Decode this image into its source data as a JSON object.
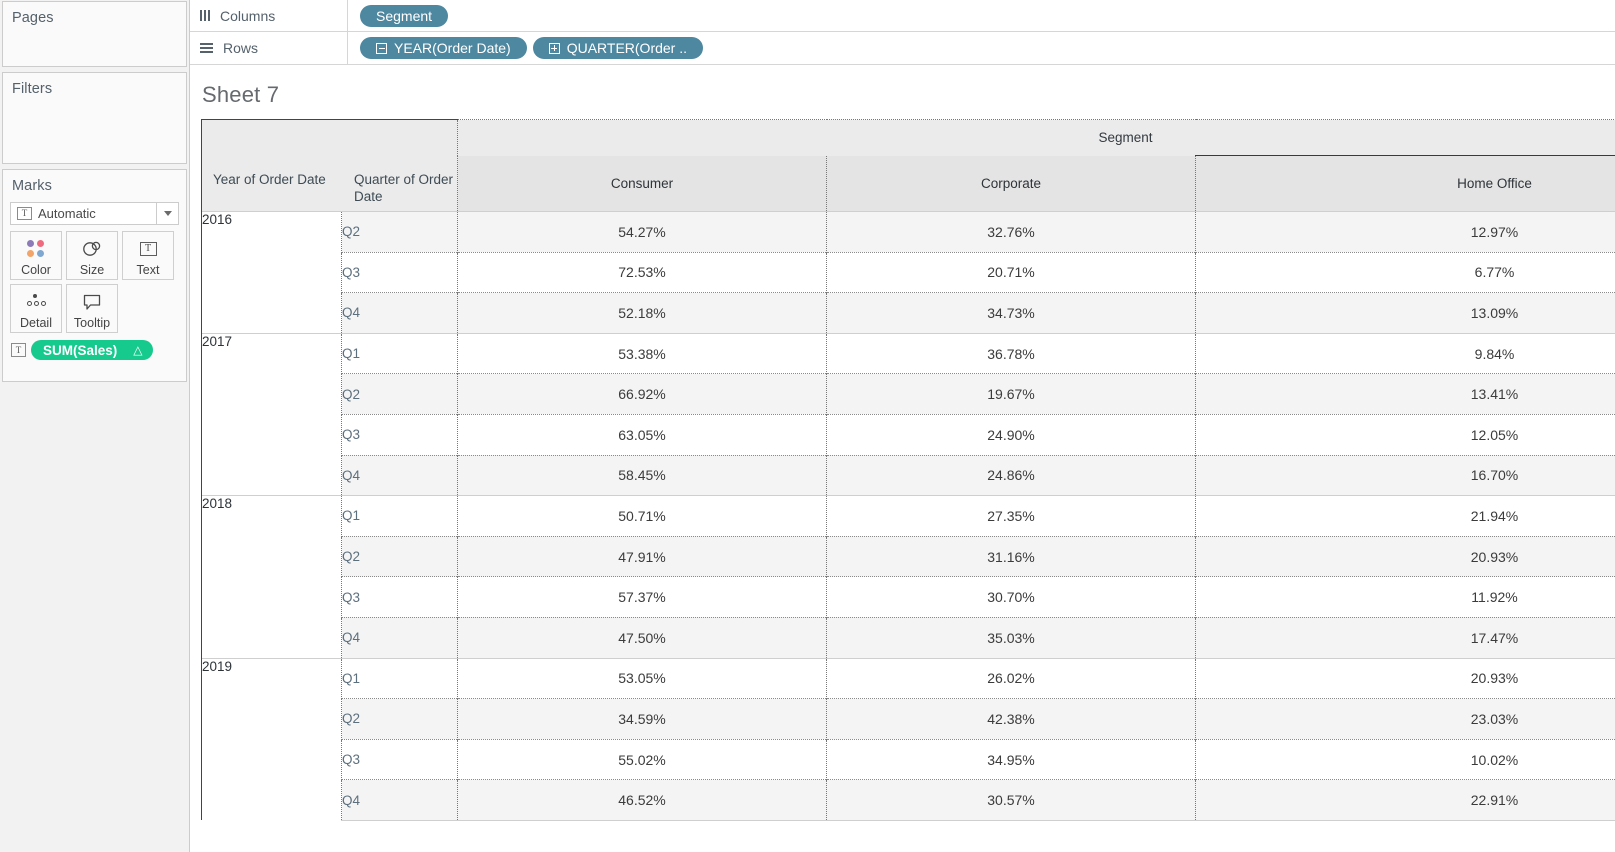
{
  "sidebar": {
    "pages": {
      "title": "Pages"
    },
    "filters": {
      "title": "Filters"
    },
    "marks": {
      "title": "Marks",
      "mark_type": "Automatic",
      "mark_type_glyph": "T",
      "buttons": [
        {
          "label": "Color",
          "icon": "color-dots-icon"
        },
        {
          "label": "Size",
          "icon": "size-circles-icon"
        },
        {
          "label": "Text",
          "icon": "text-box-icon"
        },
        {
          "label": "Detail",
          "icon": "detail-dots-icon"
        },
        {
          "label": "Tooltip",
          "icon": "tooltip-bubble-icon"
        }
      ],
      "card_pill": {
        "label": "SUM(Sales)",
        "glyph": "T",
        "badge": "△",
        "color": "#16c98d"
      }
    }
  },
  "shelves": {
    "columns": {
      "label": "Columns",
      "icon": "columns-icon",
      "pills": [
        {
          "label": "Segment",
          "expander": "none"
        }
      ]
    },
    "rows": {
      "label": "Rows",
      "icon": "rows-icon",
      "pills": [
        {
          "label": "YEAR(Order Date)",
          "expander": "minus"
        },
        {
          "label": "QUARTER(Order ..",
          "expander": "plus"
        }
      ]
    },
    "pill_color": "#4e87a0"
  },
  "sheet": {
    "title": "Sheet 7"
  },
  "chart_data": {
    "type": "table",
    "title": "Sheet 7",
    "column_group_header": "Segment",
    "row_headers": [
      "Year of Order Date",
      "Quarter of Order Date"
    ],
    "categories": [
      "Consumer",
      "Corporate",
      "Home Office"
    ],
    "measure": "SUM(Sales)",
    "value_format": "percent",
    "rows": [
      {
        "year": "2016",
        "quarter": "Q2",
        "values": [
          "54.27%",
          "32.76%",
          "12.97%"
        ]
      },
      {
        "year": "",
        "quarter": "Q3",
        "values": [
          "72.53%",
          "20.71%",
          "6.77%"
        ]
      },
      {
        "year": "",
        "quarter": "Q4",
        "values": [
          "52.18%",
          "34.73%",
          "13.09%"
        ]
      },
      {
        "year": "2017",
        "quarter": "Q1",
        "values": [
          "53.38%",
          "36.78%",
          "9.84%"
        ]
      },
      {
        "year": "",
        "quarter": "Q2",
        "values": [
          "66.92%",
          "19.67%",
          "13.41%"
        ]
      },
      {
        "year": "",
        "quarter": "Q3",
        "values": [
          "63.05%",
          "24.90%",
          "12.05%"
        ]
      },
      {
        "year": "",
        "quarter": "Q4",
        "values": [
          "58.45%",
          "24.86%",
          "16.70%"
        ]
      },
      {
        "year": "2018",
        "quarter": "Q1",
        "values": [
          "50.71%",
          "27.35%",
          "21.94%"
        ]
      },
      {
        "year": "",
        "quarter": "Q2",
        "values": [
          "47.91%",
          "31.16%",
          "20.93%"
        ]
      },
      {
        "year": "",
        "quarter": "Q3",
        "values": [
          "57.37%",
          "30.70%",
          "11.92%"
        ]
      },
      {
        "year": "",
        "quarter": "Q4",
        "values": [
          "47.50%",
          "35.03%",
          "17.47%"
        ]
      },
      {
        "year": "2019",
        "quarter": "Q1",
        "values": [
          "53.05%",
          "26.02%",
          "20.93%"
        ]
      },
      {
        "year": "",
        "quarter": "Q2",
        "values": [
          "34.59%",
          "42.38%",
          "23.03%"
        ]
      },
      {
        "year": "",
        "quarter": "Q3",
        "values": [
          "55.02%",
          "34.95%",
          "10.02%"
        ]
      },
      {
        "year": "",
        "quarter": "Q4",
        "values": [
          "46.52%",
          "30.57%",
          "22.91%"
        ]
      }
    ]
  }
}
